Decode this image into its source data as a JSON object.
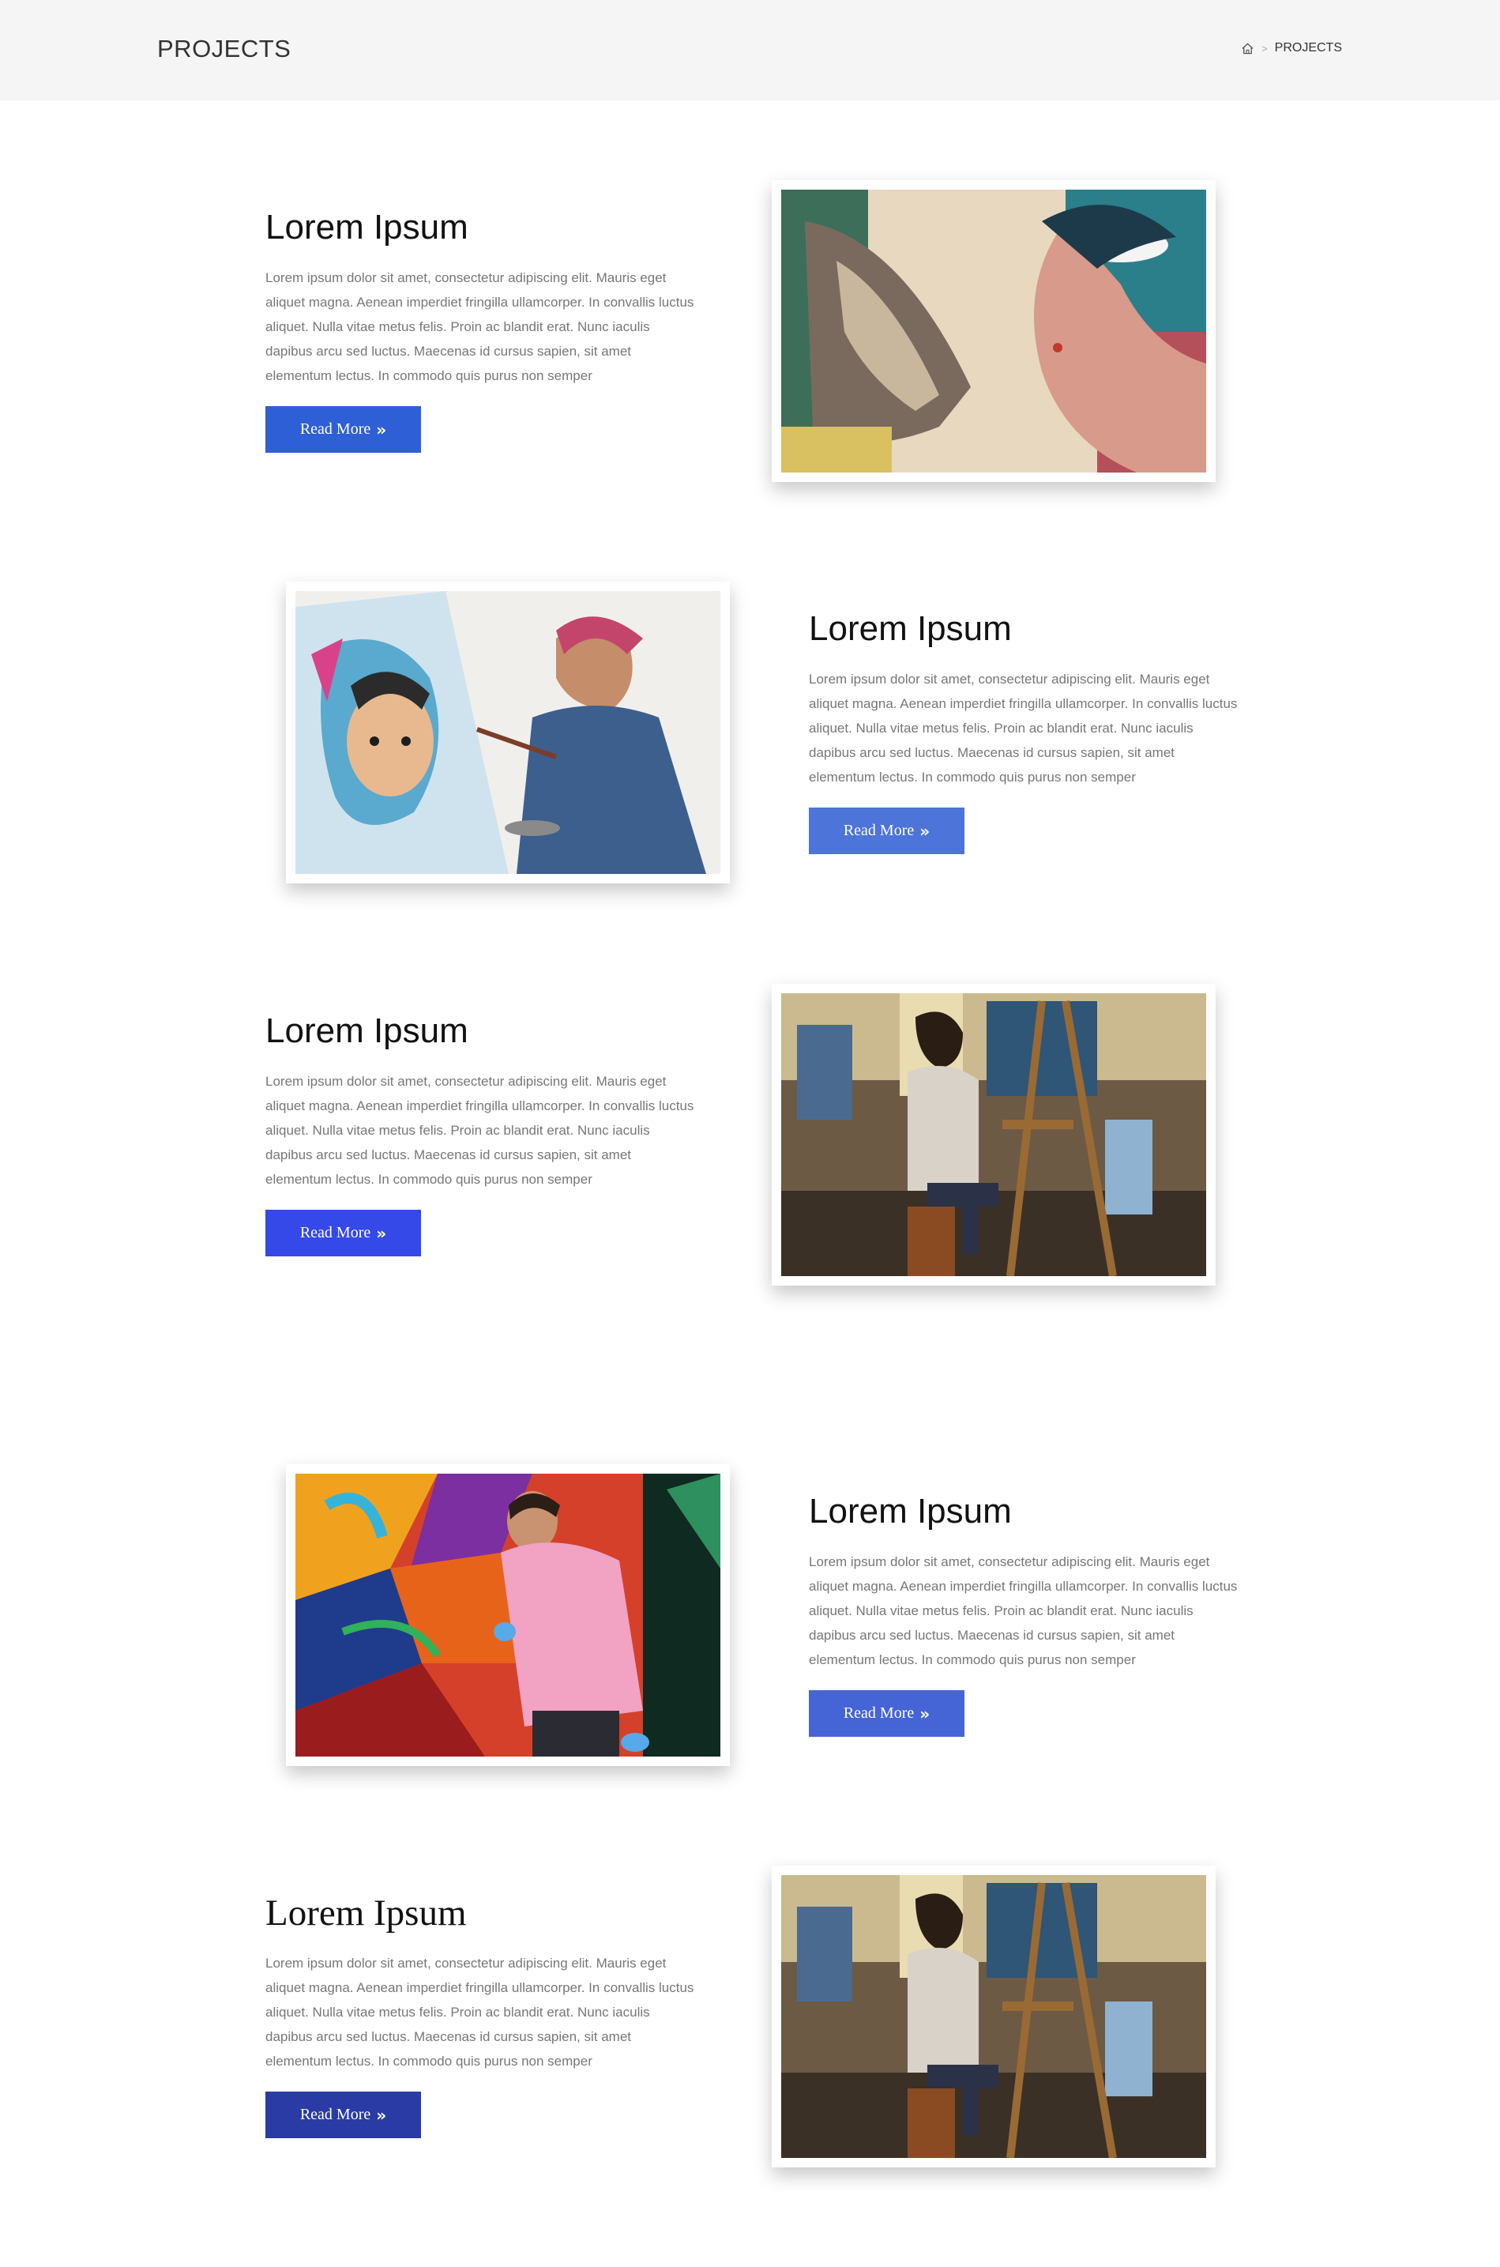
{
  "header": {
    "title": "PROJECTS",
    "breadcrumb": {
      "home_icon": "home-icon",
      "separator": ">",
      "current": "PROJECTS"
    }
  },
  "colors": {
    "header_bg": "#f5f5f5",
    "button_blue_1": "#2f5fd6",
    "button_blue_2": "#4d74d8",
    "button_blue_3": "#3548e8",
    "button_blue_4": "#4564d6",
    "button_blue_5": "#2a3ba6"
  },
  "projects": [
    {
      "title": "Lorem Ipsum",
      "text": "Lorem ipsum dolor sit amet, consectetur adipiscing elit. Mauris eget aliquet magna. Aenean imperdiet fringilla ullamcorper. In convallis luctus aliquet. Nulla vitae metus felis. Proin ac blandit erat. Nunc iaculis dapibus arcu sed luctus. Maecenas id cursus sapien, sit amet elementum lectus. In commodo quis purus non semper",
      "button": "Read More",
      "button_icon": "double-chevron-right-icon",
      "image": "wolf-and-woman-painting"
    },
    {
      "title": "Lorem Ipsum",
      "text": "Lorem ipsum dolor sit amet, consectetur adipiscing elit. Mauris eget aliquet magna. Aenean imperdiet fringilla ullamcorper. In convallis luctus aliquet. Nulla vitae metus felis. Proin ac blandit erat. Nunc iaculis dapibus arcu sed luctus. Maecenas id cursus sapien, sit amet elementum lectus. In commodo quis purus non semper",
      "button": "Read More",
      "button_icon": "double-chevron-right-icon",
      "image": "woman-painting-portrait"
    },
    {
      "title": "Lorem Ipsum",
      "text": "Lorem ipsum dolor sit amet, consectetur adipiscing elit. Mauris eget aliquet magna. Aenean imperdiet fringilla ullamcorper. In convallis luctus aliquet. Nulla vitae metus felis. Proin ac blandit erat. Nunc iaculis dapibus arcu sed luctus. Maecenas id cursus sapien, sit amet elementum lectus. In commodo quis purus non semper",
      "button": "Read More",
      "button_icon": "double-chevron-right-icon",
      "image": "artist-at-easel-studio"
    },
    {
      "title": "Lorem Ipsum",
      "text": "Lorem ipsum dolor sit amet, consectetur adipiscing elit. Mauris eget aliquet magna. Aenean imperdiet fringilla ullamcorper. In convallis luctus aliquet. Nulla vitae metus felis. Proin ac blandit erat. Nunc iaculis dapibus arcu sed luctus. Maecenas id cursus sapien, sit amet elementum lectus. In commodo quis purus non semper",
      "button": "Read More",
      "button_icon": "double-chevron-right-icon",
      "image": "man-painting-colorful-canvas"
    },
    {
      "title": "Lorem Ipsum",
      "text": "Lorem ipsum dolor sit amet, consectetur adipiscing elit. Mauris eget aliquet magna. Aenean imperdiet fringilla ullamcorper. In convallis luctus aliquet. Nulla vitae metus felis. Proin ac blandit erat. Nunc iaculis dapibus arcu sed luctus. Maecenas id cursus sapien, sit amet elementum lectus. In commodo quis purus non semper",
      "button": "Read More",
      "button_icon": "double-chevron-right-icon",
      "image": "artist-at-easel-studio"
    }
  ]
}
